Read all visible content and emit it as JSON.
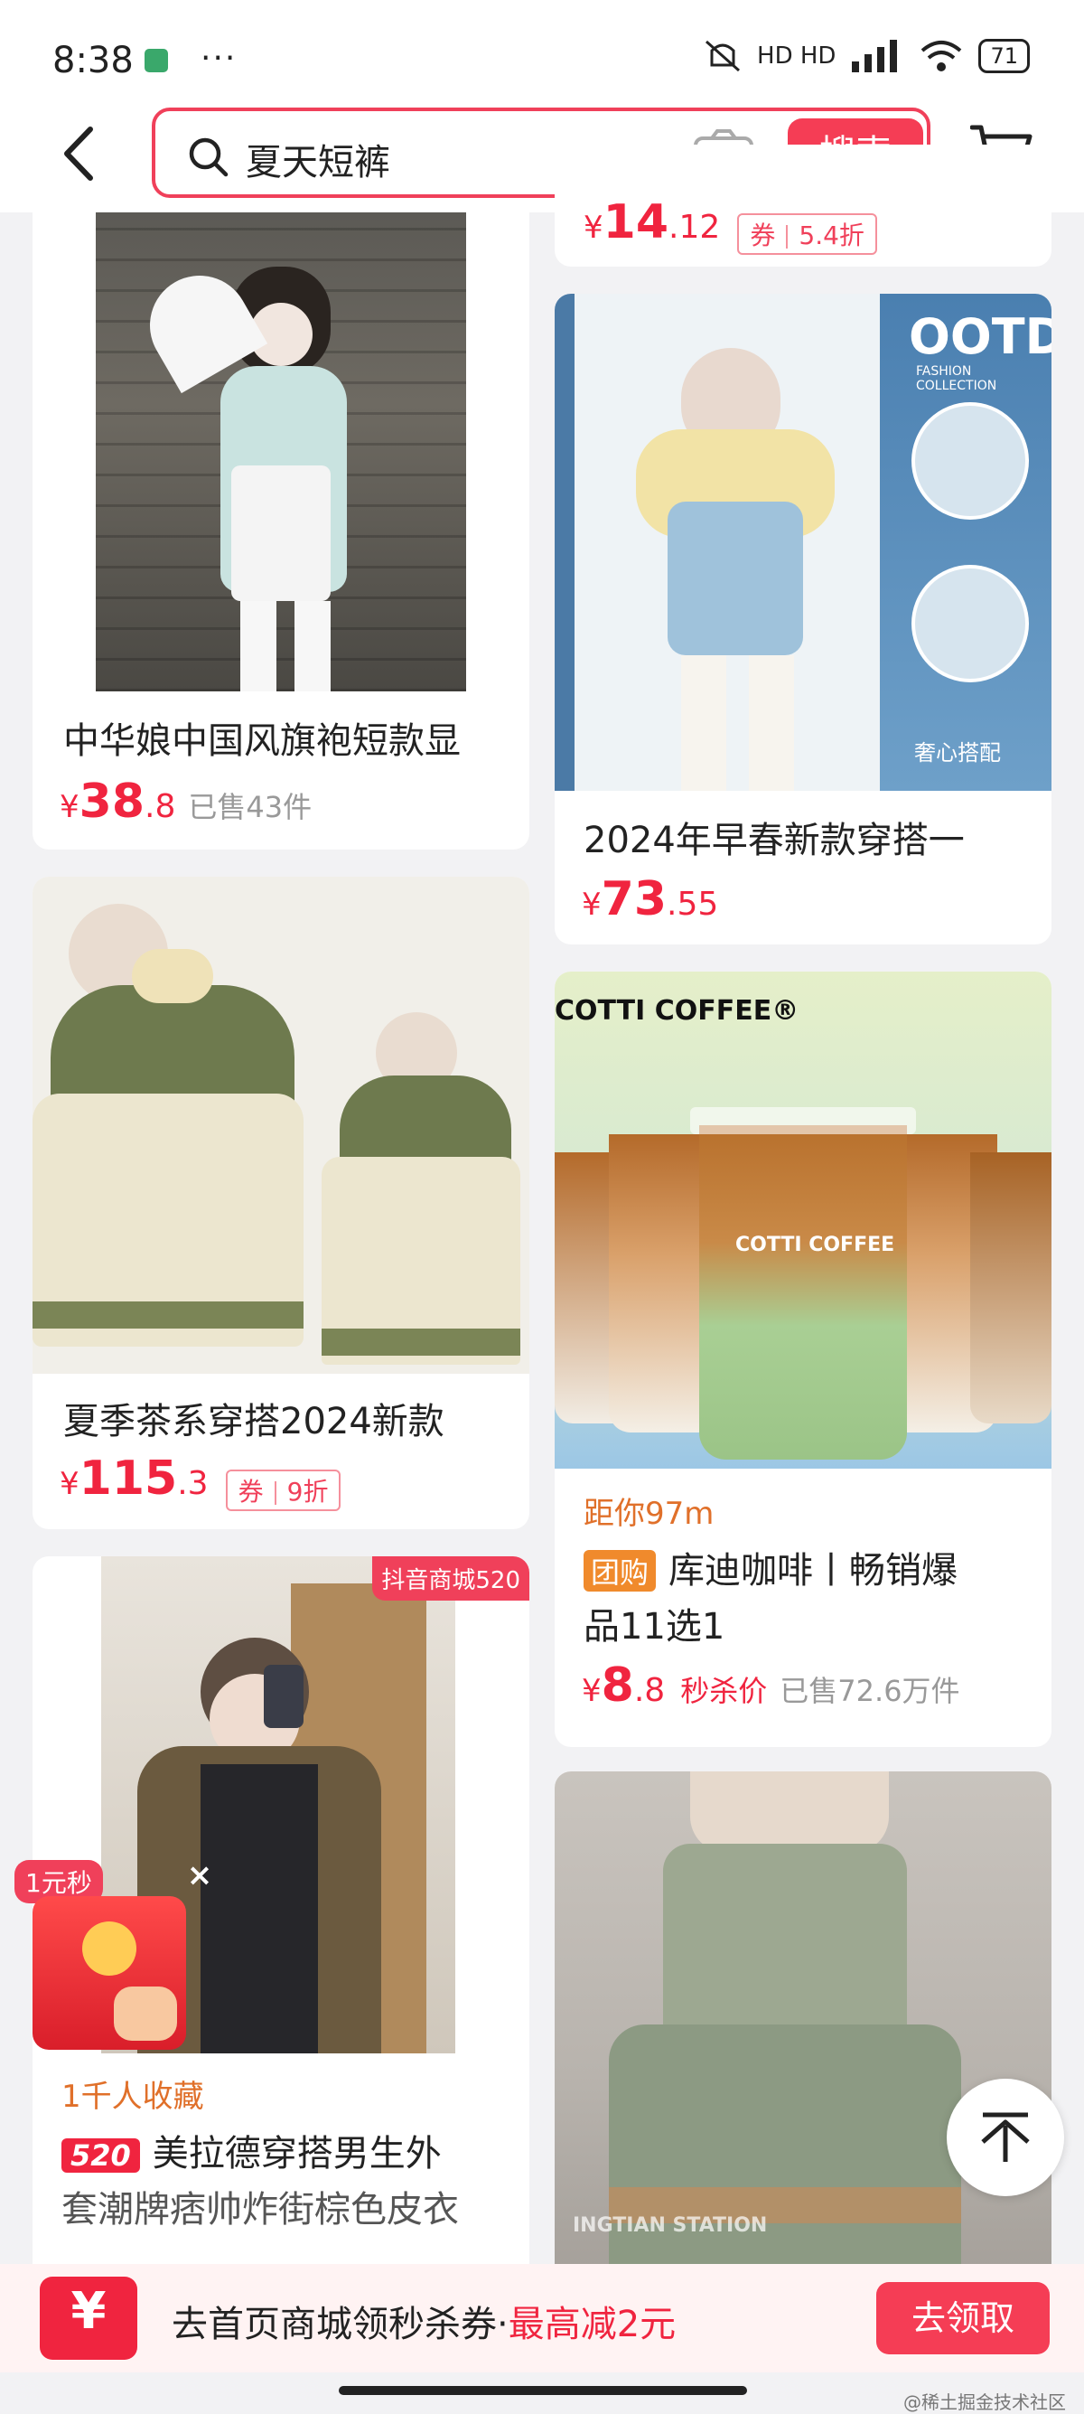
{
  "status_bar": {
    "time": "8:38",
    "dots": "···",
    "network": "HD HD",
    "battery": "71"
  },
  "header": {
    "search_query": "夏天短裤",
    "search_button": "搜索"
  },
  "products": {
    "p0": {
      "price_cur": "¥",
      "price_int": "14",
      "price_dec": ".12",
      "coupon_label": "券",
      "coupon_value": "5.4折"
    },
    "p1": {
      "title": "中华娘中国风旗袍短款显",
      "price_cur": "¥",
      "price_int": "38",
      "price_dec": ".8",
      "sold": "已售43件"
    },
    "p2": {
      "title": "2024年早春新款穿搭一",
      "price_cur": "¥",
      "price_int": "73",
      "price_dec": ".55",
      "img_text": "OOTD",
      "img_sub": "FASHION COLLECTION",
      "img_tag": "奢心搭配"
    },
    "p3": {
      "title": "夏季茶系穿搭2024新款",
      "price_cur": "¥",
      "price_int": "115",
      "price_dec": ".3",
      "coupon_label": "券",
      "coupon_value": "9折"
    },
    "p4": {
      "distance": "距你97m",
      "tag": "团购",
      "title_line1": "库迪咖啡丨畅销爆",
      "title_line2": "品11选1",
      "price_cur": "¥",
      "price_int": "8",
      "price_dec": ".8",
      "flash": "秒杀价",
      "sold": "已售72.6万件",
      "brand": "COTTI COFFEE®",
      "cup_brand": "COTTI COFFEE"
    },
    "p5": {
      "badge": "抖音商城520",
      "fav": "1千人收藏",
      "tag": "520",
      "title_line1": "美拉德穿搭男生外",
      "title_line2": "套潮牌痞帅炸街棕色皮衣"
    },
    "p6": {
      "img_text": "INGTIAN STATION"
    }
  },
  "red_packet": {
    "label": "1元秒"
  },
  "promo": {
    "text": "去首页商城领秒杀券·",
    "highlight": "最高减2元",
    "button": "去领取",
    "icon_symbol": "¥"
  },
  "watermark": "@稀土掘金技术社区",
  "colors": {
    "accent": "#f53d55",
    "price": "#f0243f",
    "orange": "#e0702a"
  }
}
